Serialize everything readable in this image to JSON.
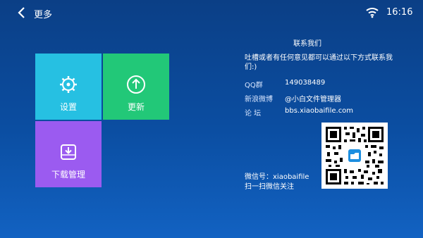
{
  "header": {
    "title": "更多",
    "back_icon": "chevron-left-icon",
    "wifi_icon": "wifi-icon",
    "time": "16:16"
  },
  "tiles": [
    {
      "label": "设置",
      "icon": "gear-icon",
      "color": "#26c0e2"
    },
    {
      "label": "更新",
      "icon": "upload-arrow-icon",
      "color": "#22c878"
    },
    {
      "label": "下载管理",
      "icon": "download-tray-icon",
      "color": "#9b5bf0"
    }
  ],
  "contact": {
    "title": "联系我们",
    "description": "吐槽或者有任何意见都可以通过以下方式联系我们:)",
    "rows": [
      {
        "label": "QQ群",
        "value": "149038489"
      },
      {
        "label": "新浪微博",
        "value": "@小白文件管理器"
      },
      {
        "label": "论 坛",
        "value": "bbs.xiaobaifile.com"
      }
    ],
    "wechat_id": "微信号：xiaobaifile",
    "wechat_hint": "扫一扫微信关注"
  }
}
